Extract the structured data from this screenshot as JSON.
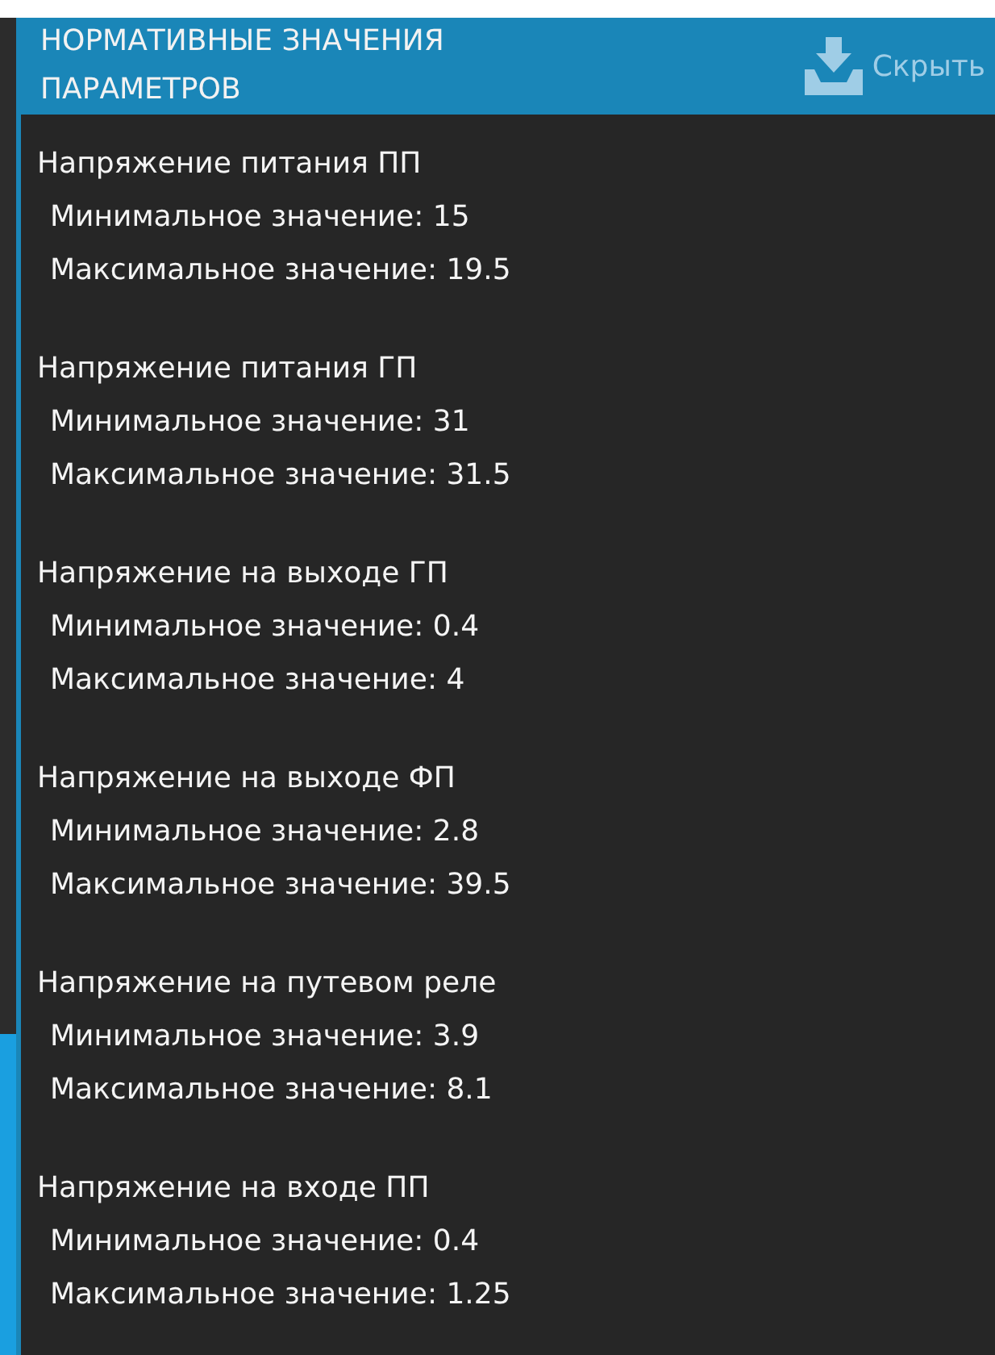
{
  "header": {
    "title": "НОРМАТИВНЫЕ ЗНАЧЕНИЯ ПАРАМЕТРОВ",
    "hide_button": "Скрыть"
  },
  "parameters": [
    {
      "name": "Напряжение питания ПП",
      "min": "Минимальное значение: 15",
      "max": "Максимальное значение: 19.5"
    },
    {
      "name": "Напряжение питания ГП",
      "min": "Минимальное значение: 31",
      "max": "Максимальное значение: 31.5"
    },
    {
      "name": "Напряжение на выходе ГП",
      "min": "Минимальное значение: 0.4",
      "max": "Максимальное значение: 4"
    },
    {
      "name": "Напряжение на выходе ФП",
      "min": "Минимальное значение: 2.8",
      "max": "Максимальное значение: 39.5"
    },
    {
      "name": "Напряжение на путевом реле",
      "min": "Минимальное значение: 3.9",
      "max": "Максимальное значение: 8.1"
    },
    {
      "name": "Напряжение на входе ПП",
      "min": "Минимальное значение: 0.4",
      "max": "Максимальное значение: 1.25"
    }
  ]
}
